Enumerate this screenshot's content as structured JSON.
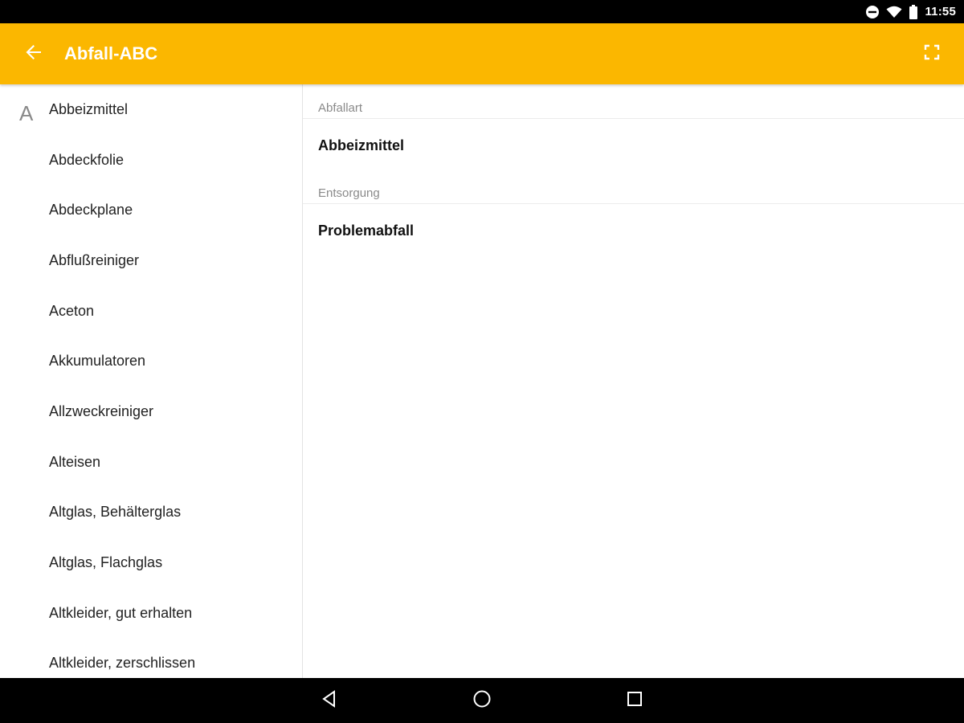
{
  "status_bar": {
    "time": "11:55",
    "icons": [
      "do-not-disturb-icon",
      "wifi-icon",
      "battery-icon"
    ]
  },
  "app_bar": {
    "title": "Abfall-ABC",
    "background_color": "#fbb700",
    "back_icon": "arrow-back-icon",
    "fullscreen_icon": "fullscreen-icon"
  },
  "list": {
    "section_letter": "A",
    "items": [
      {
        "label": "Abbeizmittel"
      },
      {
        "label": "Abdeckfolie"
      },
      {
        "label": "Abdeckplane"
      },
      {
        "label": "Abflußreiniger"
      },
      {
        "label": "Aceton"
      },
      {
        "label": "Akkumulatoren"
      },
      {
        "label": "Allzweckreiniger"
      },
      {
        "label": "Alteisen"
      },
      {
        "label": "Altglas, Behälterglas"
      },
      {
        "label": "Altglas, Flachglas"
      },
      {
        "label": "Altkleider, gut erhalten"
      },
      {
        "label": "Altkleider, zerschlissen"
      }
    ]
  },
  "detail": {
    "fields": [
      {
        "header": "Abfallart",
        "value": "Abbeizmittel"
      },
      {
        "header": "Entsorgung",
        "value": "Problemabfall"
      }
    ]
  },
  "nav_bar": {
    "buttons": [
      "back-triangle-icon",
      "home-circle-icon",
      "recents-square-icon"
    ]
  }
}
